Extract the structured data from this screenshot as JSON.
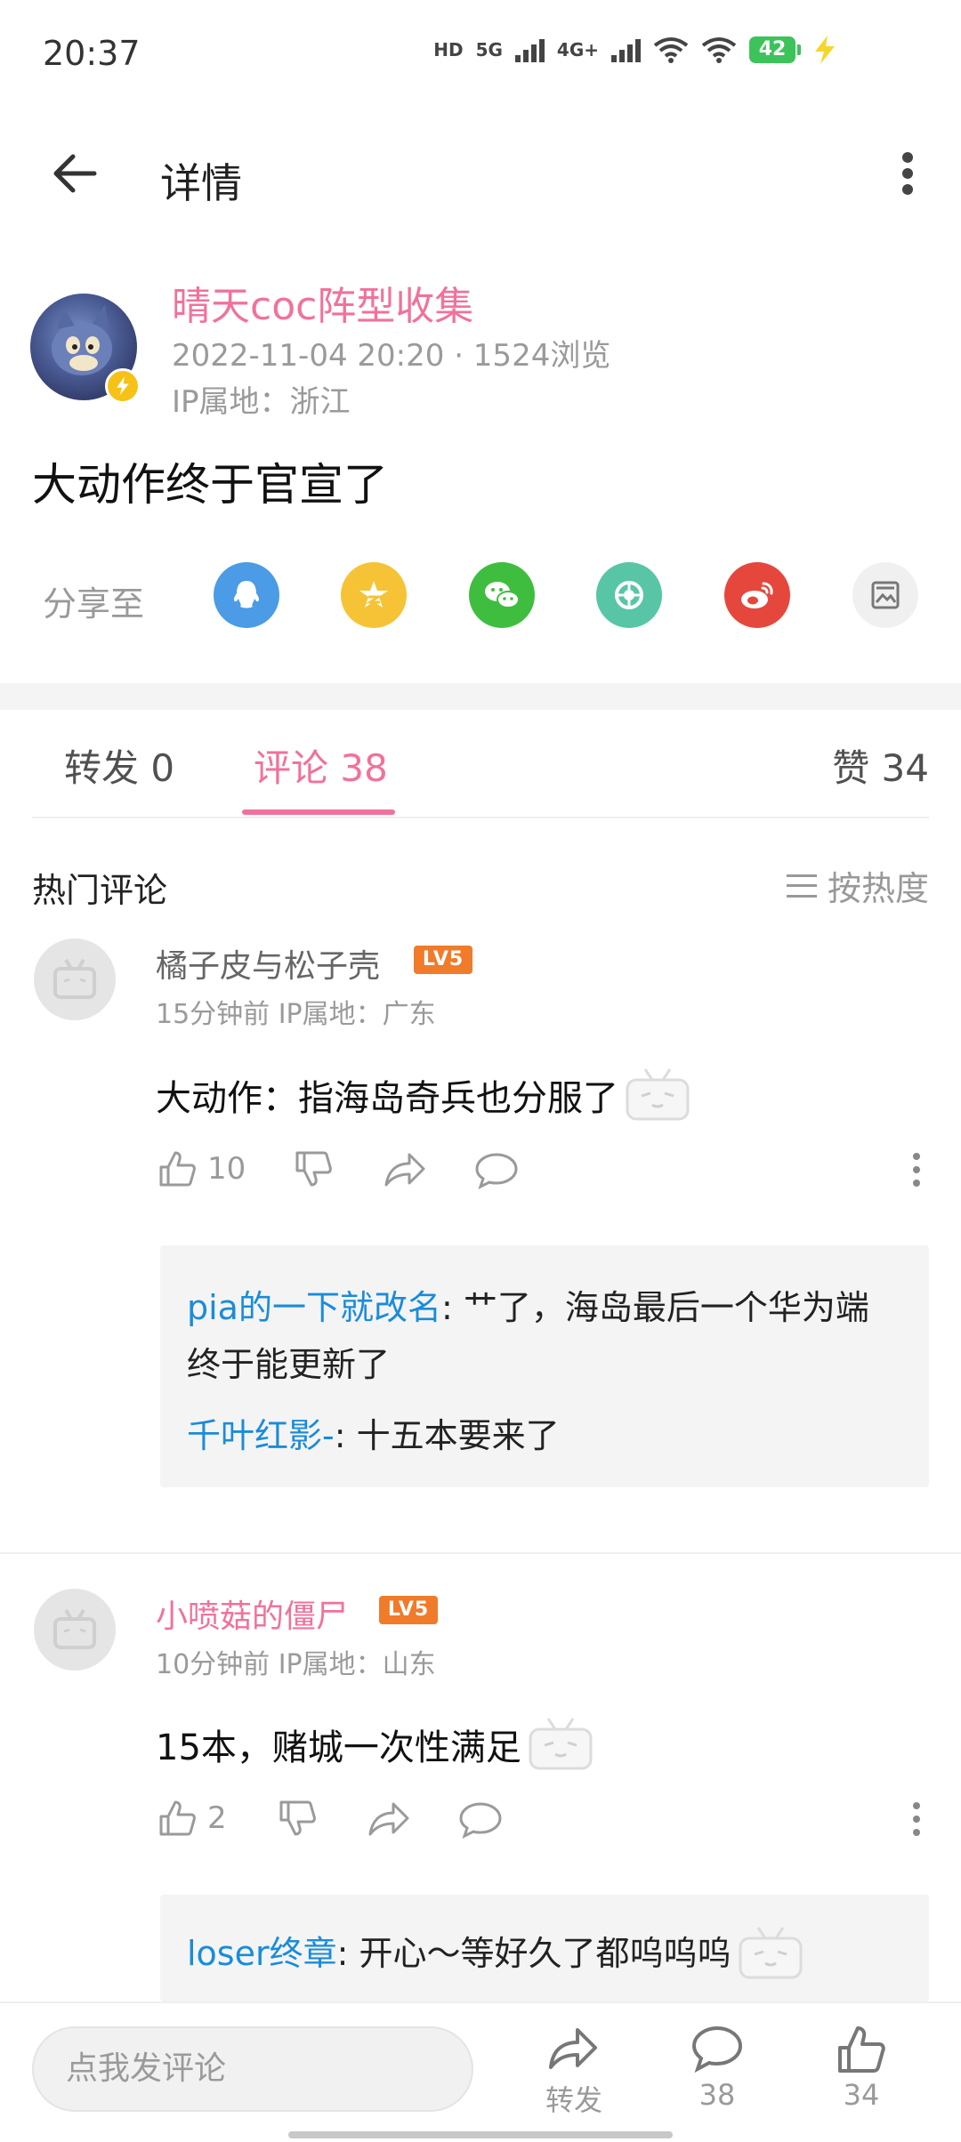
{
  "status_bar": {
    "time": "20:37",
    "hd": "HD",
    "net1": "5G",
    "net2": "4G+",
    "battery": "42"
  },
  "header": {
    "title": "详情"
  },
  "post": {
    "author": "晴天coc阵型收集",
    "meta": "2022-11-04 20:20  ·  1524浏览",
    "ip": "IP属地：浙江",
    "body": "大动作终于官宣了"
  },
  "share": {
    "label": "分享至",
    "targets": [
      "qq-icon",
      "qzone-icon",
      "wechat-icon",
      "moments-icon",
      "weibo-icon",
      "image-icon"
    ],
    "colors": {
      "qq": "#4b9be6",
      "qzone": "#f5c335",
      "wechat": "#3fbd3f",
      "moments": "#58c6a6",
      "weibo": "#e5473c",
      "image": "#f0f0f0"
    }
  },
  "tabs": {
    "repost": "转发 0",
    "comments": "评论 38",
    "likes": "赞 34"
  },
  "hot": {
    "title": "热门评论",
    "sort": "按热度"
  },
  "comments": [
    {
      "user": "橘子皮与松子壳",
      "level": "LV5",
      "meta": "15分钟前  IP属地：广东",
      "text": "大动作：指海岛奇兵也分服了",
      "likes": "10",
      "replies": [
        {
          "user": "pia的一下就改名",
          "text": ": 艹了，海岛最后一个华为端终于能更新了"
        },
        {
          "user": "千叶红影-",
          "text": ": 十五本要来了"
        }
      ]
    },
    {
      "user": "小喷菇的僵尸",
      "level": "LV5",
      "meta": "10分钟前  IP属地：山东",
      "text": "15本，赌城一次性满足",
      "likes": "2",
      "replies": [
        {
          "user": "loser终章",
          "text": ": 开心～等好久了都呜呜呜"
        }
      ]
    }
  ],
  "bottom_bar": {
    "input_placeholder": "点我发评论",
    "repost_label": "转发",
    "comment_count": "38",
    "like_count": "34"
  },
  "colors": {
    "accent": "#f0729b",
    "link": "#1a8cd8",
    "level_badge": "#f07b2a"
  }
}
